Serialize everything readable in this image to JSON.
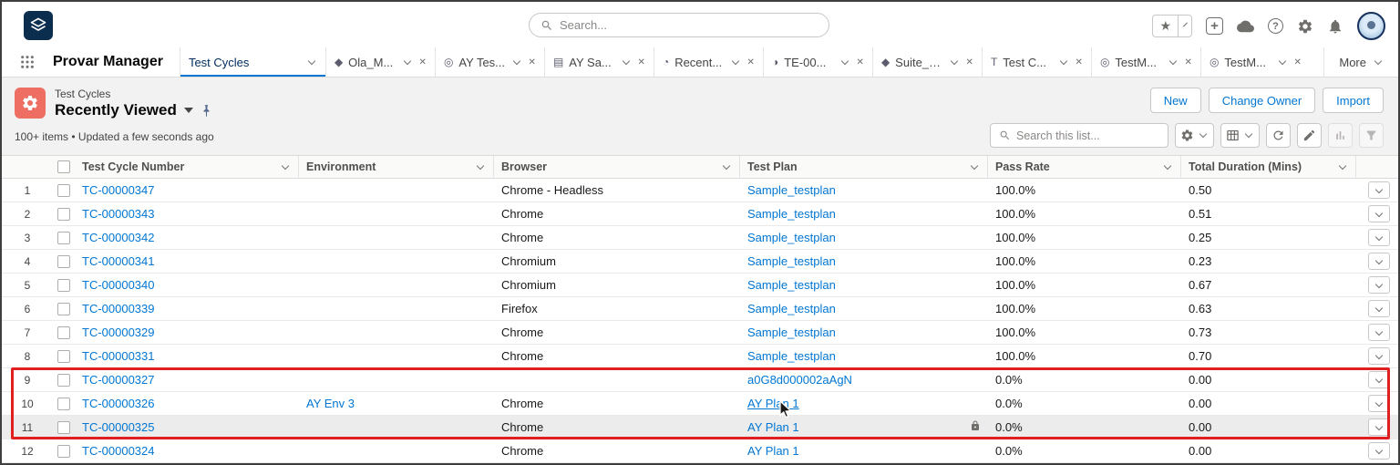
{
  "global_header": {
    "search_placeholder": "Search...",
    "icons": {
      "favorites_glyph": "★",
      "plus_glyph": "+",
      "help_glyph": "?",
      "action_names": [
        "favorites-star",
        "global-actions-plus",
        "guidance-cloud",
        "help",
        "setup-gear",
        "notifications-bell",
        "user-avatar"
      ]
    }
  },
  "nav": {
    "app_name": "Provar Manager",
    "more_label": "More",
    "tab_close_glyph": "✕",
    "tabs": [
      {
        "label": "Test Cycles",
        "active": true,
        "closable": false,
        "glyph": ""
      },
      {
        "label": "Ola_M...",
        "closable": true,
        "glyph": "◆"
      },
      {
        "label": "AY Tes...",
        "closable": true,
        "glyph": "◎"
      },
      {
        "label": "AY Sa...",
        "closable": true,
        "glyph": "▤"
      },
      {
        "label": "Recent...",
        "closable": true,
        "glyph": "◔"
      },
      {
        "label": "TE-00...",
        "closable": true,
        "glyph": "◑"
      },
      {
        "label": "Suite_1...",
        "closable": true,
        "glyph": "◆"
      },
      {
        "label": "Test C...",
        "closable": true,
        "glyph": "T"
      },
      {
        "label": "TestM...",
        "closable": true,
        "glyph": "◎"
      },
      {
        "label": "TestM...",
        "closable": true,
        "glyph": "◎"
      }
    ]
  },
  "page_header": {
    "entity_label": "Test Cycles",
    "list_view_name": "Recently Viewed",
    "buttons": [
      "New",
      "Change Owner",
      "Import"
    ],
    "meta": "100+ items • Updated a few seconds ago",
    "list_search_placeholder": "Search this list...",
    "accent_color": "#0176d3",
    "object_icon_color": "#ef6e64"
  },
  "table": {
    "columns": [
      "Test Cycle Number",
      "Environment",
      "Browser",
      "Test Plan",
      "Pass Rate",
      "Total Duration (Mins)"
    ],
    "rows": [
      {
        "num": "1",
        "cycle": "TC-00000347",
        "env": "",
        "browser": "Chrome - Headless",
        "plan": "Sample_testplan",
        "pass": "100.0%",
        "duration": "0.50"
      },
      {
        "num": "2",
        "cycle": "TC-00000343",
        "env": "",
        "browser": "Chrome",
        "plan": "Sample_testplan",
        "pass": "100.0%",
        "duration": "0.51"
      },
      {
        "num": "3",
        "cycle": "TC-00000342",
        "env": "",
        "browser": "Chrome",
        "plan": "Sample_testplan",
        "pass": "100.0%",
        "duration": "0.25"
      },
      {
        "num": "4",
        "cycle": "TC-00000341",
        "env": "",
        "browser": "Chromium",
        "plan": "Sample_testplan",
        "pass": "100.0%",
        "duration": "0.23"
      },
      {
        "num": "5",
        "cycle": "TC-00000340",
        "env": "",
        "browser": "Chromium",
        "plan": "Sample_testplan",
        "pass": "100.0%",
        "duration": "0.67"
      },
      {
        "num": "6",
        "cycle": "TC-00000339",
        "env": "",
        "browser": "Firefox",
        "plan": "Sample_testplan",
        "pass": "100.0%",
        "duration": "0.63"
      },
      {
        "num": "7",
        "cycle": "TC-00000329",
        "env": "",
        "browser": "Chrome",
        "plan": "Sample_testplan",
        "pass": "100.0%",
        "duration": "0.73"
      },
      {
        "num": "8",
        "cycle": "TC-00000331",
        "env": "",
        "browser": "Chrome",
        "plan": "Sample_testplan",
        "pass": "100.0%",
        "duration": "0.70"
      },
      {
        "num": "9",
        "cycle": "TC-00000327",
        "env": "",
        "browser": "",
        "plan": "a0G8d000002aAgN",
        "pass": "0.0%",
        "duration": "0.00"
      },
      {
        "num": "10",
        "cycle": "TC-00000326",
        "env": "AY Env 3",
        "browser": "Chrome",
        "plan": "AY Plan 1",
        "pass": "0.0%",
        "duration": "0.00",
        "plan_hovered": true
      },
      {
        "num": "11",
        "cycle": "TC-00000325",
        "env": "",
        "browser": "Chrome",
        "plan": "AY Plan 1",
        "pass": "0.0%",
        "duration": "0.00",
        "locked": true,
        "highlighted": true
      },
      {
        "num": "12",
        "cycle": "TC-00000324",
        "env": "",
        "browser": "Chrome",
        "plan": "AY Plan 1",
        "pass": "0.0%",
        "duration": "0.00"
      }
    ]
  },
  "annotation": {
    "color": "#e02020"
  }
}
